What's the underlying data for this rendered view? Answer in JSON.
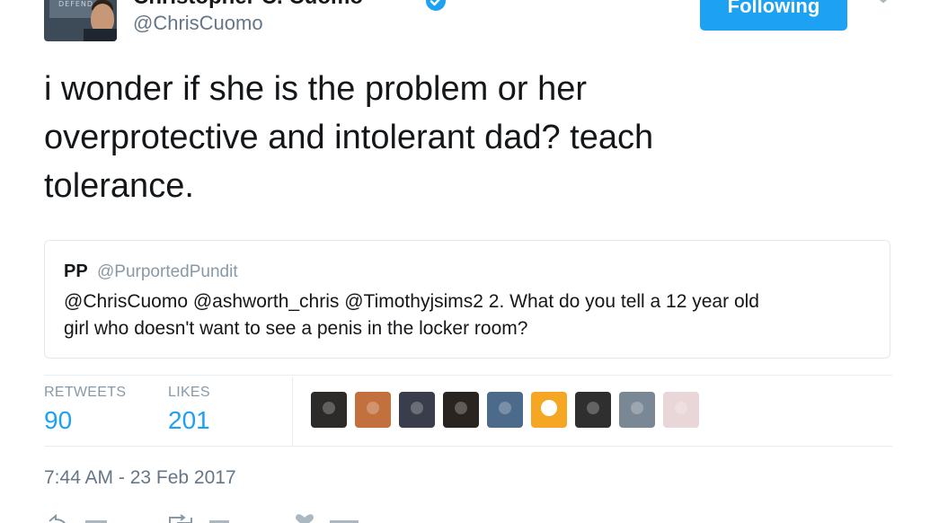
{
  "tweet": {
    "author": {
      "display_name": "Christopher C. Cuomo",
      "handle": "@ChrisCuomo",
      "avatar_sign_text": "DEFEND"
    },
    "follow_button_label": "Following",
    "text": "i wonder if she is the problem or her\noverprotective and intolerant dad? teach\ntolerance.",
    "quoted": {
      "name": "PP",
      "handle": "@PurportedPundit",
      "text": "@ChrisCuomo @ashworth_chris @Timothyjsims2 2. What do you tell a 12 year old\ngirl who doesn't want to see a penis in the locker room?"
    },
    "stats": {
      "retweets_label": "RETWEETS",
      "retweets_value": "90",
      "likes_label": "LIKES",
      "likes_value": "201"
    },
    "likers": [
      {
        "name": "liker-avatar-1",
        "color": "#2c2b2a"
      },
      {
        "name": "liker-avatar-2",
        "color": "#c2703e"
      },
      {
        "name": "liker-avatar-3",
        "color": "#3a3e4c"
      },
      {
        "name": "liker-avatar-4",
        "color": "#2a2420"
      },
      {
        "name": "liker-avatar-5",
        "color": "#4c6a8a"
      },
      {
        "name": "liker-avatar-6",
        "color": "#f5a623"
      },
      {
        "name": "liker-avatar-7",
        "color": "#2f2f2f"
      },
      {
        "name": "liker-avatar-8",
        "color": "#7a8896"
      },
      {
        "name": "liker-avatar-9",
        "color": "#e8d6d8"
      }
    ],
    "timestamp": "7:44 AM - 23 Feb 2017",
    "icons": {
      "verified": "verified-badge-icon",
      "menu": "chevron-down-icon",
      "reply": "reply-icon",
      "retweet": "retweet-icon",
      "like": "heart-icon"
    },
    "colors": {
      "accent": "#1da1f2",
      "secondary_text": "#657786",
      "border": "#e1e8ed"
    }
  }
}
